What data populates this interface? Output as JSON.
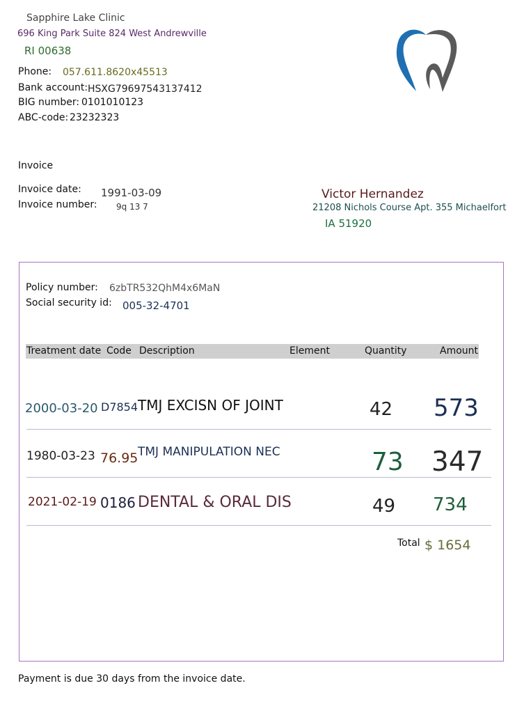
{
  "clinic": {
    "name": "Sapphire Lake Clinic",
    "address_line1": "696 King Park Suite 824 West Andrewville",
    "address_line2": "RI 00638",
    "phone_label": "Phone:",
    "phone": "057.611.8620x45513",
    "bank_label": "Bank account:",
    "bank": "HSXG79697543137412",
    "big_label": "BIG number:",
    "big": "0101010123",
    "abc_label": "ABC-code:",
    "abc": "23232323"
  },
  "logo": {
    "icon": "tooth-icon",
    "colors": [
      "#1f6fb2",
      "#5a5a5a"
    ]
  },
  "invoice": {
    "title": "Invoice",
    "date_label": "Invoice date:",
    "date": "1991-03-09",
    "number_label": "Invoice number:",
    "number": "9q 13 7"
  },
  "recipient": {
    "name": "Victor Hernandez",
    "address_line1": "21208 Nichols Course Apt. 355 Michaelfort",
    "address_line2": "IA 51920"
  },
  "policy": {
    "policy_label": "Policy number:",
    "policy_number": "6zbTR532QhM4x6MaN",
    "ssn_label": "Social security id:",
    "ssn": "005-32-4701"
  },
  "table": {
    "headers": [
      "Treatment date",
      "Code",
      "Description",
      "Element",
      "Quantity",
      "Amount"
    ],
    "rows": [
      {
        "date": "2000-03-20",
        "code": "D7854",
        "description": "TMJ EXCISN OF JOINT",
        "element": "",
        "quantity": "42",
        "amount": "573"
      },
      {
        "date": "1980-03-23",
        "code": "76.95",
        "description": "TMJ MANIPULATION NEC",
        "element": "",
        "quantity": "73",
        "amount": "347"
      },
      {
        "date": "2021-02-19",
        "code": "0186",
        "description": "DENTAL & ORAL DIS",
        "element": "",
        "quantity": "49",
        "amount": "734"
      }
    ],
    "total_label": "Total",
    "total": "$ 1654"
  },
  "footer": {
    "note": "Payment is due 30 days from the invoice date."
  },
  "colors": {
    "box_border": "#a675c4",
    "header_bar": "#cfcfcf",
    "green": "#1e5e3a",
    "navy": "#1b2f55",
    "maroon": "#5a1a2a",
    "purple": "#5a2a6a"
  }
}
